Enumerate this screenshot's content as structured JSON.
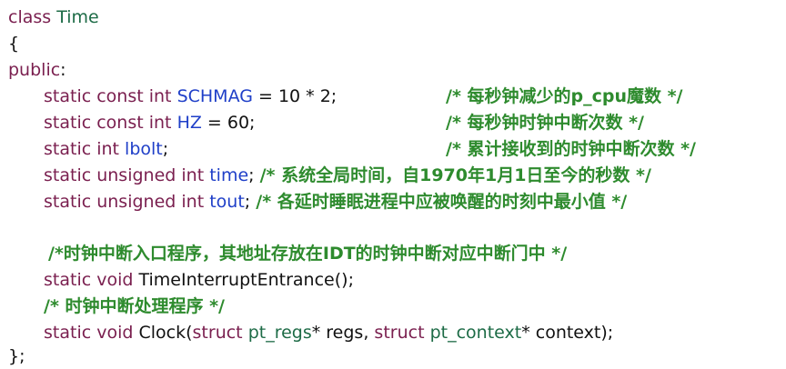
{
  "code": {
    "l1": {
      "kw": "class",
      "name": "Time"
    },
    "l2": {
      "brace": "{"
    },
    "l3": {
      "kw": "public",
      "colon": ":"
    },
    "l4": {
      "static": "static",
      "const": "const",
      "int": "int",
      "ident": "SCHMAG",
      "rest": " = 10 * 2;",
      "comment": "/* 每秒钟减少的p_cpu魔数 */"
    },
    "l5": {
      "static": "static",
      "const": "const",
      "int": "int",
      "ident": "HZ",
      "rest": " = 60;",
      "comment": "/* 每秒钟时钟中断次数 */"
    },
    "l6": {
      "static": "static",
      "int": "int",
      "ident": "lbolt",
      "rest": ";",
      "comment": "/* 累计接收到的时钟中断次数 */"
    },
    "l7": {
      "static": "static",
      "unsigned": "unsigned",
      "int": "int",
      "ident": "time",
      "rest": ";",
      "comment": "/* 系统全局时间，自1970年1月1日至今的秒数 */"
    },
    "l8": {
      "static": "static",
      "unsigned": "unsigned",
      "int": "int",
      "ident": "tout",
      "rest": ";",
      "comment": "/* 各延时睡眠进程中应被唤醒的时刻中最小值 */"
    },
    "l10": {
      "comment": "/*时钟中断入口程序，其地址存放在IDT的时钟中断对应中断门中 */"
    },
    "l11": {
      "static": "static",
      "void": "void",
      "func": "TimeInterruptEntrance();"
    },
    "l12": {
      "comment": "/* 时钟中断处理程序 */"
    },
    "l13": {
      "static": "static",
      "void": "void",
      "func": "Clock(",
      "struct1": "struct",
      "type1": "pt_regs",
      "arg1": "* regs, ",
      "struct2": "struct",
      "type2": "pt_context",
      "arg2": "* context);"
    },
    "l14": {
      "close": "};"
    }
  }
}
